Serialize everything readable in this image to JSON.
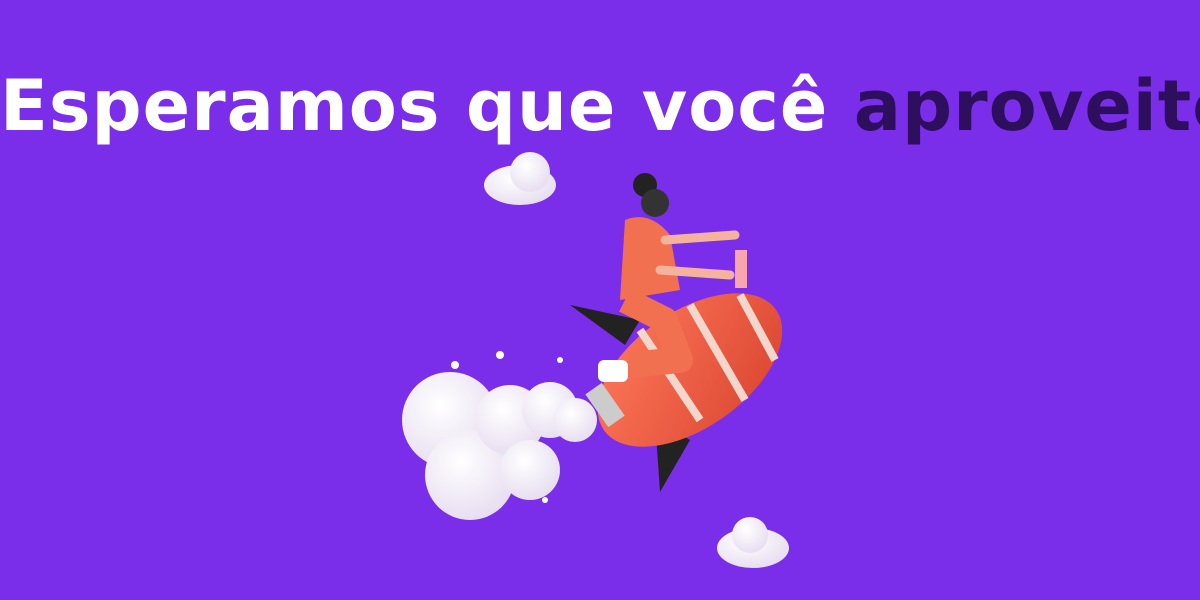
{
  "headline": {
    "text_main": "Esperamos que você",
    "text_accent": "aproveite"
  },
  "colors": {
    "background": "#7B2EEA",
    "headline": "#FFFFFF",
    "accent": "#2E0F5E",
    "rocket": "#F0624A"
  }
}
